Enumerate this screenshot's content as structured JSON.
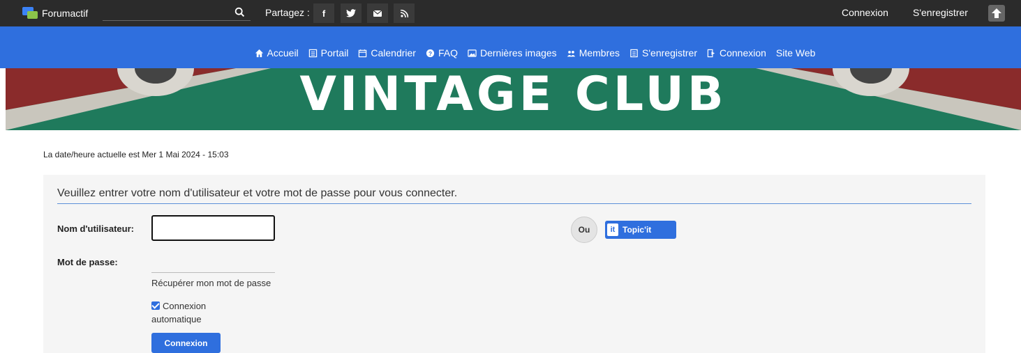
{
  "topbar": {
    "brand": "Forumactif",
    "share_label": "Partagez :",
    "social": [
      "f",
      "twitter",
      "mail",
      "rss"
    ],
    "login_link": "Connexion",
    "register_link": "S'enregistrer"
  },
  "nav": {
    "items": [
      {
        "label": "Accueil",
        "icon": "home-icon"
      },
      {
        "label": "Portail",
        "icon": "portal-icon"
      },
      {
        "label": "Calendrier",
        "icon": "calendar-icon"
      },
      {
        "label": "FAQ",
        "icon": "help-icon"
      },
      {
        "label": "Dernières images",
        "icon": "images-icon"
      },
      {
        "label": "Membres",
        "icon": "members-icon"
      },
      {
        "label": "S'enregistrer",
        "icon": "register-icon"
      },
      {
        "label": "Connexion",
        "icon": "login-icon"
      },
      {
        "label": "Site Web",
        "icon": ""
      }
    ]
  },
  "banner": {
    "title": "VINTAGE CLUB"
  },
  "date_line": "La date/heure actuelle est Mer 1 Mai 2024 - 15:03",
  "login": {
    "heading": "Veuillez entrer votre nom d'utilisateur et votre mot de passe pour vous connecter.",
    "username_label": "Nom d'utilisateur:",
    "username_value": "",
    "password_label": "Mot de passe:",
    "recover_link": "Récupérer mon mot de passe",
    "auto_login_label": "Connexion automatique",
    "auto_login_checked": true,
    "submit_label": "Connexion",
    "or_label": "Ou",
    "topicit_label": "Topic'it",
    "topicit_logo": "it"
  },
  "colors": {
    "topbar": "#2b2b2b",
    "navbar": "#2f6fde",
    "banner": "#1f7a5c",
    "accent": "#2f6fde"
  }
}
